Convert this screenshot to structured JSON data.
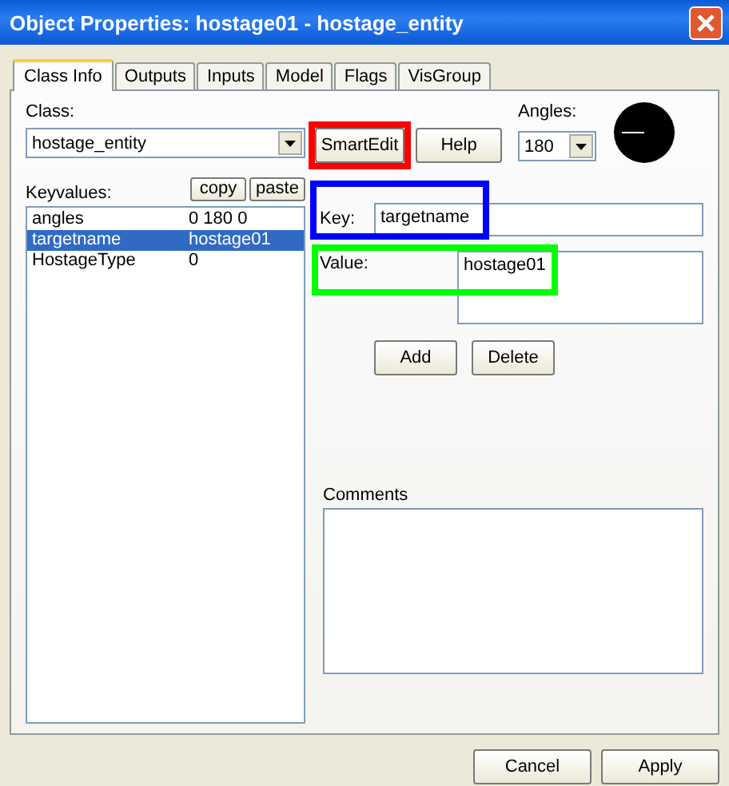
{
  "window": {
    "title": "Object Properties: hostage01 - hostage_entity"
  },
  "tabs": [
    {
      "label": "Class Info",
      "selected": true
    },
    {
      "label": "Outputs",
      "selected": false
    },
    {
      "label": "Inputs",
      "selected": false
    },
    {
      "label": "Model",
      "selected": false
    },
    {
      "label": "Flags",
      "selected": false
    },
    {
      "label": "VisGroup",
      "selected": false
    }
  ],
  "class": {
    "label": "Class:",
    "value": "hostage_entity"
  },
  "smartedit_button": {
    "label": "SmartEdit",
    "color": "#ff0000"
  },
  "help_button": {
    "label": "Help"
  },
  "angles": {
    "label": "Angles:",
    "value": "180"
  },
  "keyvalues": {
    "label": "Keyvalues:",
    "copy": "copy",
    "paste": "paste",
    "rows": [
      {
        "key": "angles",
        "value": "0 180 0",
        "selected": false
      },
      {
        "key": "targetname",
        "value": "hostage01",
        "selected": true
      },
      {
        "key": "HostageType",
        "value": "0",
        "selected": false
      }
    ]
  },
  "key": {
    "label": "Key:",
    "value": "targetname",
    "color": "#0000ff"
  },
  "value": {
    "label": "Value:",
    "value": "hostage01",
    "color": "#00ff00"
  },
  "add_button": "Add",
  "delete_button": "Delete",
  "comments": {
    "label": "Comments"
  },
  "buttons": [
    "Cancel",
    "Apply"
  ]
}
